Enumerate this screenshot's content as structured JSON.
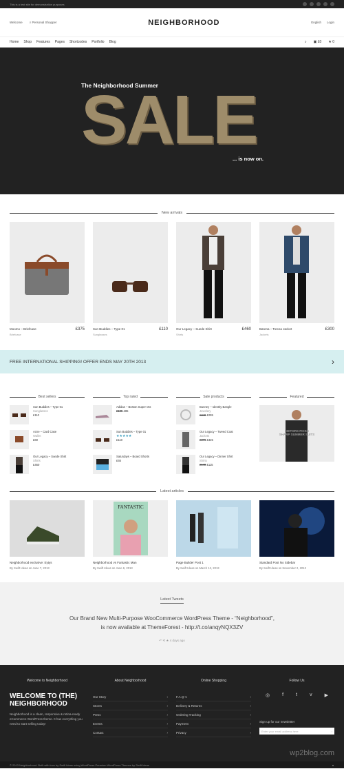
{
  "topbar": {
    "text": "This is a test site for demonstration purposes"
  },
  "header": {
    "welcome": "Welcome",
    "search": "Personal Shopper",
    "logo": "NEIGHBORHOOD",
    "lang": "English",
    "login": "Login"
  },
  "nav": {
    "items": [
      "Home",
      "Shop",
      "Features",
      "Pages",
      "Shortcodes",
      "Portfolio",
      "Blog"
    ],
    "cart": "£0",
    "wish": "0"
  },
  "hero": {
    "title": "The Neighborhood Summer",
    "sale": "SALE",
    "sub": "... is now on."
  },
  "new_arrivals": {
    "title": "New arrivals",
    "products": [
      {
        "name": "Moomo – Briefcase",
        "price": "£375",
        "cat": "Briefcase"
      },
      {
        "name": "Sun Buddies – Type 01",
        "price": "£110",
        "cat": "Sunglasses"
      },
      {
        "name": "Our Legacy – Suede Shirt",
        "price": "£460",
        "cat": "Shirts"
      },
      {
        "name": "Barena – Torcea Jacket",
        "price": "£300",
        "cat": "Jackets"
      }
    ]
  },
  "shipping": {
    "text": "FREE INTERNATIONAL SHIPPING! OFFER ENDS MAY 20TH 2013"
  },
  "best": {
    "title": "Best sellers",
    "items": [
      {
        "name": "Sun Buddies – Type 01",
        "cat": "Sunglasses",
        "price": "£110"
      },
      {
        "name": "Acne – Card Case",
        "cat": "Wallet",
        "price": "£60"
      },
      {
        "name": "Our Legacy – Suede Shirt",
        "cat": "Shirts",
        "price": "£460"
      }
    ]
  },
  "top": {
    "title": "Top rated",
    "items": [
      {
        "name": "Adidas – Boston Super OG",
        "old": "£105",
        "price": "£85"
      },
      {
        "name": "Sun Buddies – Type 01",
        "stars": "★★★★★",
        "price": "£110"
      },
      {
        "name": "Saturdays – Board Shorts",
        "price": "£65"
      }
    ]
  },
  "sale": {
    "title": "Sale products",
    "items": [
      {
        "name": "Bunney – Identity Bangle",
        "cat": "Jewelery",
        "old": "£348",
        "price": "£295"
      },
      {
        "name": "Our Legacy – Tweed Coat",
        "cat": "Jackets",
        "old": "£376",
        "price": "£325"
      },
      {
        "name": "Our Legacy – Dinner Shirt",
        "cat": "Shirts",
        "old": "£140",
        "price": "£115"
      }
    ]
  },
  "featured": {
    "title": "Featured",
    "label1": "EDITORS PICKS",
    "label2": "SHARP SUMMER SUITS"
  },
  "latest": {
    "title": "Latest articles",
    "items": [
      {
        "title": "Neighborhood exclusive: Eytys",
        "by": "By Swift Ideas on June 7, 2013"
      },
      {
        "title": "Neighborhood vs Fantastic Man",
        "by": "By Swift Ideas on June 6, 2013"
      },
      {
        "title": "Page Builder Post 1",
        "by": "By Swift Ideas on March 12, 2013"
      },
      {
        "title": "Standard Post No Sidebar",
        "by": "By Swift Ideas on November 2, 2012"
      }
    ]
  },
  "tweets": {
    "title": "Latest Tweets",
    "line1": "Our Brand New Multi-Purpose WooCommerce WordPress Theme - “Neighborhood”,",
    "line2": "is now available at ThemeForest - http://t.co/anqyNQX3ZV",
    "time": "4 days ago"
  },
  "footer": {
    "c1": {
      "title": "Welcome to Neighborhood",
      "w1": "WELCOME TO (THE)",
      "w2": "NEIGHBORHOOD",
      "desc": "Neighborhood is a clean, responsive & retina-ready eCommerce WordPress theme. It has everything you need to start selling today!"
    },
    "c2": {
      "title": "About Neighborhood",
      "links": [
        "Our Story",
        "Stores",
        "Press",
        "Events",
        "Contact"
      ]
    },
    "c3": {
      "title": "Online Shopping",
      "links": [
        "F.A.Q.'s",
        "Delivery & Returns",
        "Ordering Tracking",
        "Payment",
        "Privacy"
      ]
    },
    "c4": {
      "title": "Follow Us",
      "signup": "Sign up for our newsletter",
      "placeholder": "Enter your email address here"
    },
    "copyright": "© 2013 Neighborhood. Built with love by Swift Ideas using WordPress Premium WordPress Themes by Swift Ideas",
    "watermark": "wp2blog.com"
  }
}
